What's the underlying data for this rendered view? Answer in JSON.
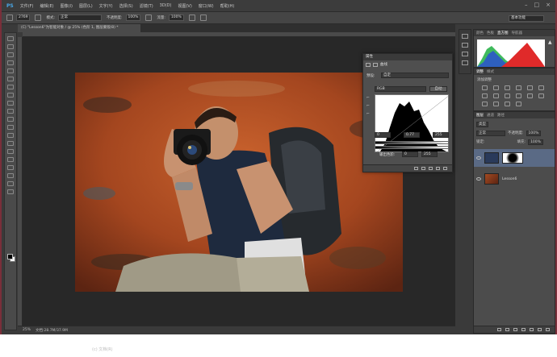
{
  "app": {
    "logo": "PS",
    "menus": [
      "文件(F)",
      "编辑(E)",
      "图像(I)",
      "图层(L)",
      "文字(Y)",
      "选择(S)",
      "滤镜(T)",
      "3D(D)",
      "视图(V)",
      "窗口(W)",
      "帮助(H)"
    ],
    "window_controls": [
      "–",
      "□",
      "×"
    ]
  },
  "options_bar": {
    "brush_size": "2769",
    "mode_label": "模式:",
    "mode_value": "正常",
    "opacity_label": "不透明度:",
    "opacity_value": "100%",
    "flow_label": "流量:",
    "flow_value": "100%",
    "workspace": "基本功能"
  },
  "document": {
    "tab_title": "(C) \"Lesson6\"为智能对象 / @ 25% (色阶 1, 图层蒙版/8) *",
    "status_zoom": "25%",
    "status_doc": "文档:28.7M/37.9M"
  },
  "curves": {
    "header": "属性",
    "sub_title": "曲线",
    "preset_label": "预设:",
    "preset_value": "自定",
    "channel_value": "RGB",
    "auto_button": "自动",
    "input_black": "0",
    "input_gamma": "0.77",
    "input_white": "255",
    "output_label": "输出色阶:",
    "output_black": "0",
    "output_white": "255"
  },
  "histogram_panel": {
    "tabs": [
      "颜色",
      "色板",
      "直方图",
      "导航器"
    ],
    "active_tab": "直方图"
  },
  "adjustments_panel": {
    "tabs": [
      "调整",
      "样式"
    ],
    "title": "添加调整"
  },
  "layers_panel": {
    "tabs": [
      "图层",
      "通道",
      "路径"
    ],
    "kind_label": "类型",
    "blend_mode": "正常",
    "opacity_label": "不透明度:",
    "opacity_value": "100%",
    "lock_label": "锁定:",
    "fill_label": "填充:",
    "fill_value": "100%",
    "layers": [
      {
        "name": "",
        "selected": true
      },
      {
        "name": "Lesson6",
        "selected": false
      }
    ]
  },
  "taskbar": {
    "text": "(c) 文档(R)"
  }
}
